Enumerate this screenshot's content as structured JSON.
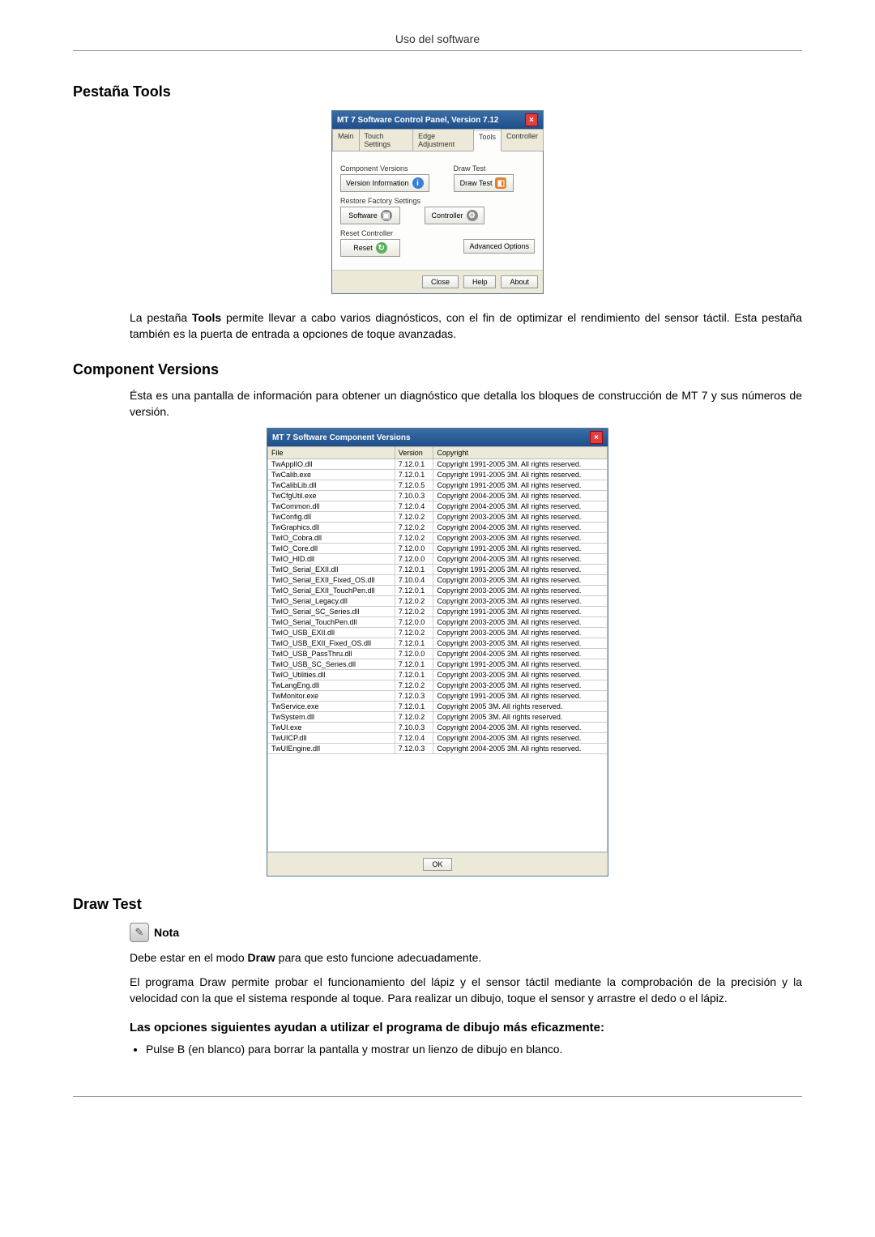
{
  "header": {
    "page_title": "Uso del software"
  },
  "sections": {
    "tools_heading": "Pestaña Tools",
    "tools_para_1a": "La pestaña ",
    "tools_para_1b": "Tools",
    "tools_para_1c": " permite llevar a cabo varios diagnósticos, con el fin de optimizar el rendimiento del sensor táctil. Esta pestaña también es la puerta de entrada a opciones de toque avanzadas.",
    "cv_heading": "Component Versions",
    "cv_para": "Ésta es una pantalla de información para obtener un diagnóstico que detalla los bloques de construcción de MT 7 y sus números de versión.",
    "draw_heading": "Draw Test",
    "note_label": "Nota",
    "draw_note_a": "Debe estar en el modo ",
    "draw_note_b": "Draw",
    "draw_note_c": " para que esto funcione adecuadamente.",
    "draw_para": "El programa Draw permite probar el funcionamiento del lápiz y el sensor táctil mediante la comprobación de la precisión y la velocidad con la que el sistema responde al toque. Para realizar un dibujo, toque el sensor y arrastre el dedo o el lápiz.",
    "draw_subhead": "Las opciones siguientes ayudan a utilizar el programa de dibujo más eficazmente:",
    "draw_bullet_1": "Pulse B (en blanco) para borrar la pantalla y mostrar un lienzo de dibujo en blanco."
  },
  "control_panel": {
    "title": "MT 7 Software Control Panel, Version 7.12",
    "tabs": [
      "Main",
      "Touch Settings",
      "Edge Adjustment",
      "Tools",
      "Controller"
    ],
    "active_tab_index": 3,
    "groups": {
      "component_versions": "Component Versions",
      "draw_test": "Draw Test",
      "restore_factory": "Restore Factory Settings",
      "reset_controller": "Reset Controller"
    },
    "buttons": {
      "version_info": "Version Information",
      "draw_test": "Draw Test",
      "software": "Software",
      "controller": "Controller",
      "reset": "Reset",
      "advanced": "Advanced Options"
    },
    "footer": {
      "close": "Close",
      "help": "Help",
      "about": "About"
    }
  },
  "cv_window": {
    "title": "MT 7 Software Component Versions",
    "headers": {
      "file": "File",
      "version": "Version",
      "copyright": "Copyright"
    },
    "rows": [
      {
        "file": "TwApplIO.dll",
        "version": "7.12.0.1",
        "copyright": "Copyright 1991-2005 3M. All rights reserved."
      },
      {
        "file": "TwCalib.exe",
        "version": "7.12.0.1",
        "copyright": "Copyright 1991-2005 3M. All rights reserved."
      },
      {
        "file": "TwCalibLib.dll",
        "version": "7.12.0.5",
        "copyright": "Copyright 1991-2005 3M. All rights reserved."
      },
      {
        "file": "TwCfgUtil.exe",
        "version": "7.10.0.3",
        "copyright": "Copyright 2004-2005 3M. All rights reserved."
      },
      {
        "file": "TwCommon.dll",
        "version": "7.12.0.4",
        "copyright": "Copyright 2004-2005 3M. All rights reserved."
      },
      {
        "file": "TwConfig.dll",
        "version": "7.12.0.2",
        "copyright": "Copyright 2003-2005 3M. All rights reserved."
      },
      {
        "file": "TwGraphics.dll",
        "version": "7.12.0.2",
        "copyright": "Copyright 2004-2005 3M. All rights reserved."
      },
      {
        "file": "TwIO_Cobra.dll",
        "version": "7.12.0.2",
        "copyright": "Copyright 2003-2005 3M. All rights reserved."
      },
      {
        "file": "TwIO_Core.dll",
        "version": "7.12.0.0",
        "copyright": "Copyright 1991-2005 3M. All rights reserved."
      },
      {
        "file": "TwIO_HID.dll",
        "version": "7.12.0.0",
        "copyright": "Copyright 2004-2005 3M. All rights reserved."
      },
      {
        "file": "TwIO_Serial_EXII.dll",
        "version": "7.12.0.1",
        "copyright": "Copyright 1991-2005 3M. All rights reserved."
      },
      {
        "file": "TwIO_Serial_EXII_Fixed_OS.dll",
        "version": "7.10.0.4",
        "copyright": "Copyright 2003-2005 3M. All rights reserved."
      },
      {
        "file": "TwIO_Serial_EXII_TouchPen.dll",
        "version": "7.12.0.1",
        "copyright": "Copyright 2003-2005 3M. All rights reserved."
      },
      {
        "file": "TwIO_Serial_Legacy.dll",
        "version": "7.12.0.2",
        "copyright": "Copyright 2003-2005 3M. All rights reserved."
      },
      {
        "file": "TwIO_Serial_SC_Series.dll",
        "version": "7.12.0.2",
        "copyright": "Copyright 1991-2005 3M. All rights reserved."
      },
      {
        "file": "TwIO_Serial_TouchPen.dll",
        "version": "7.12.0.0",
        "copyright": "Copyright 2003-2005 3M. All rights reserved."
      },
      {
        "file": "TwIO_USB_EXII.dll",
        "version": "7.12.0.2",
        "copyright": "Copyright 2003-2005 3M. All rights reserved."
      },
      {
        "file": "TwIO_USB_EXII_Fixed_OS.dll",
        "version": "7.12.0.1",
        "copyright": "Copyright 2003-2005 3M. All rights reserved."
      },
      {
        "file": "TwIO_USB_PassThru.dll",
        "version": "7.12.0.0",
        "copyright": "Copyright 2004-2005 3M. All rights reserved."
      },
      {
        "file": "TwIO_USB_SC_Series.dll",
        "version": "7.12.0.1",
        "copyright": "Copyright 1991-2005 3M. All rights reserved."
      },
      {
        "file": "TwIO_Utilities.dll",
        "version": "7.12.0.1",
        "copyright": "Copyright 2003-2005 3M. All rights reserved."
      },
      {
        "file": "TwLangEng.dll",
        "version": "7.12.0.2",
        "copyright": "Copyright 2003-2005 3M. All rights reserved."
      },
      {
        "file": "TwMonitor.exe",
        "version": "7.12.0.3",
        "copyright": "Copyright 1991-2005 3M. All rights reserved."
      },
      {
        "file": "TwService.exe",
        "version": "7.12.0.1",
        "copyright": "Copyright 2005 3M. All rights reserved."
      },
      {
        "file": "TwSystem.dll",
        "version": "7.12.0.2",
        "copyright": "Copyright 2005 3M. All rights reserved."
      },
      {
        "file": "TwUI.exe",
        "version": "7.10.0.3",
        "copyright": "Copyright 2004-2005 3M. All rights reserved."
      },
      {
        "file": "TwUICP.dll",
        "version": "7.12.0.4",
        "copyright": "Copyright 2004-2005 3M. All rights reserved."
      },
      {
        "file": "TwUIEngine.dll",
        "version": "7.12.0.3",
        "copyright": "Copyright 2004-2005 3M. All rights reserved."
      }
    ],
    "ok": "OK"
  }
}
